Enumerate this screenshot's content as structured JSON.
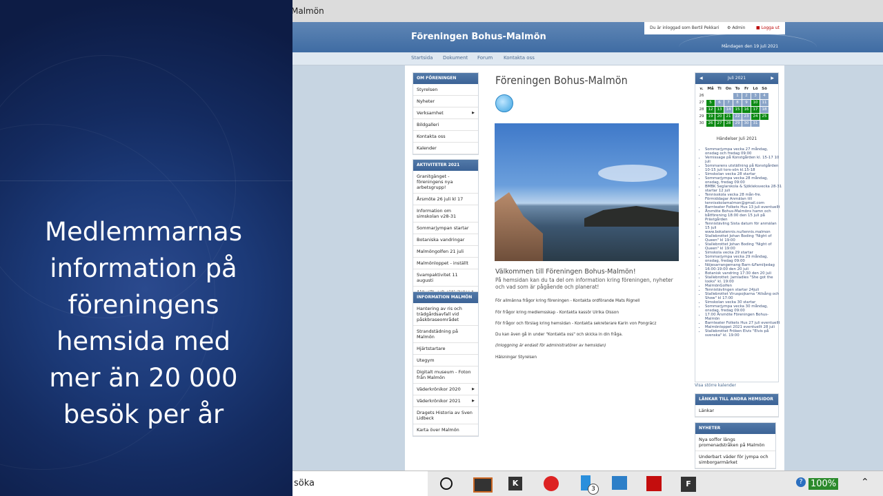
{
  "locale": "sv-SE",
  "slide": {
    "title_lines": [
      "Medlemmarnas",
      "information på",
      "föreningens",
      "hemsida med",
      "mer än 20 000",
      "besök per år"
    ]
  },
  "browser": {
    "window_title": "Malmön"
  },
  "site": {
    "name": "Föreningen Bohus-Malmön",
    "logged_in_text": "Du är inloggad som Bertil Pekkari",
    "admin_label": "Admin",
    "logout_label": "Logga ut",
    "date": "Måndagen den 19 juli 2021",
    "nav": [
      "Startsida",
      "Dokument",
      "Forum",
      "Kontakta oss"
    ]
  },
  "left_sidebar": {
    "about": {
      "title": "OM FÖRENINGEN",
      "items": [
        "Styrelsen",
        "Nyheter",
        "Verksamhet",
        "Bildgalleri",
        "Kontakta oss",
        "Kalender"
      ]
    },
    "activities": {
      "title": "AKTIVITETER 2021",
      "items": [
        "Granitgänget - föreningens nya arbetsgrupp!",
        "Årsmöte 26 juli kl 17",
        "Information om simskolan v28-31",
        "Sommarjympan startar",
        "Botaniska vandringar",
        "Malmöngolfen 21 juli",
        "Malmönloppet - inställt",
        "Svampaktivitet 11 augusti",
        "Aktuellt- och aktiviteter"
      ]
    },
    "info": {
      "title": "INFORMATION MALMÖN",
      "items": [
        "Hantering av ris och trädgårdsavfall vid påskbraseområdet",
        "Strandstädning på Malmön",
        "Hjärtstartare",
        "Utegym",
        "Digitalt museum - Foton från Malmön",
        "Väderkrönikor 2020",
        "Väderkrönikor 2021",
        "Dragets Historia av Sven Lidbeck",
        "Karta över Malmön"
      ]
    }
  },
  "main": {
    "title": "Föreningen Bohus-Malmön",
    "welcome_heading": "Välkommen till Föreningen Bohus-Malmön!",
    "welcome_text": "På hemsidan kan du ta del om information kring föreningen, nyheter och vad som är pågående och planerat!",
    "paragraphs": [
      "För allmänna frågor kring föreningen - Kontakta ordförande Mats Rignell",
      "För frågor kring medlemsskap - Kontakta kassör Ulrika Olsson",
      "För frågor och förslag kring hemsidan - Kontakta sekreterare Karin von Pongrácz",
      "Du kan även gå in under \"Kontakta oss\" och skicka in din fråga.",
      "(Inloggning är endast för administratörer av hemsidan)",
      "Hälsningar Styrelsen"
    ]
  },
  "calendar": {
    "month_label": "Juli 2021",
    "headers": [
      "v.",
      "Må",
      "Ti",
      "On",
      "To",
      "Fr",
      "Lö",
      "Sö"
    ],
    "weeks": [
      {
        "wk": "26",
        "days": [
          "",
          "",
          "",
          "1",
          "2",
          "3",
          "4"
        ]
      },
      {
        "wk": "27",
        "days": [
          "5",
          "6",
          "7",
          "8",
          "9",
          "10",
          "11"
        ]
      },
      {
        "wk": "28",
        "days": [
          "12",
          "13",
          "14",
          "15",
          "16",
          "17",
          "18"
        ]
      },
      {
        "wk": "29",
        "days": [
          "19",
          "20",
          "21",
          "22",
          "23",
          "24",
          "25"
        ]
      },
      {
        "wk": "30",
        "days": [
          "26",
          "27",
          "28",
          "29",
          "30",
          "31",
          ""
        ]
      }
    ],
    "events_title": "Händelser Juli 2021",
    "events": [
      "Sommarjympa vecka 27 måndag, onsdag och fredag 09:00",
      "Vernissage på Konstgården kl. 15-17 10 juli",
      "Sommarens utställning på Konstgården 10-15 juli tors-sön kl.15-18",
      "Simskolan vecka 28 startar",
      "Sommarjympa vecka 28 måndag, onsdag, fredag 09:00",
      "BMBK Seglarskola & Sjökleksvecka 28-31 startar 12 juli",
      "Tennisskola vecka 28 mån-fre. Förmiddagar Anmälan till tennisskolamalmon@gmail.com",
      "Barnteater Folkets Hus 13 juli eventuellt",
      "Årsmöte Bohus-Malmöns hamn och båtförening 18:00 den 15 juli på Prästgården",
      "Tennistävling Sista datum för anmälan 15 juli www.bokatennis.nu/tennis.malmon",
      "Stallebrottet Johan Boding \"Night of Queen\" kl 19:00",
      "Stallebrottet Johan Boding \"Night of Queen\" kl 19:00",
      "Simskola vecka 29 startar",
      "Sommarjympa vecka 29 måndag, onsdag, fredag 09:00",
      "Nöjesarrangemang Barn-&Familjedag 16:00-19:00 den 20 juli",
      "Botanisk vandring 17:30 den 20 juli",
      "Stallebrottet: Jamladies \"She got the looks\" kl. 19:00",
      "MalmönGolfen",
      "Tennistävlingen startar 24juli",
      "Stallebrottet Viruspojkarna \"Allsång och Show\" kl 17:00",
      "Simskolan vecka 30 startar",
      "Sommarjympa vecka 30 måndag, onsdag, fredag 09:00",
      "17:00 Årsmöte Föreningen Bohus-Malmön",
      "Barnteater Folkets Hus 27 juli eventuellt",
      "Malmönloppet 2021 eventuellt 28 juli",
      "Stallebrottet Fröken Elvis \"Elvis på svenska\" kl. 19:00"
    ],
    "bigger_link": "Visa större kalender"
  },
  "right_sidebar": {
    "links": {
      "title": "LÄNKAR TILL ANDRA HEMSIDOR",
      "items": [
        "Länkar"
      ]
    },
    "news": {
      "title": "NYHETER",
      "items": [
        "Nya soffor längs promenadstråken på Malmön",
        "Underbart väder för jympa och simborgarmärket"
      ]
    }
  },
  "taskbar": {
    "search_placeholder": "söka",
    "zoom": "100%",
    "badge_count": "3",
    "taskbar_icons": [
      "cortana-icon",
      "media-app-icon",
      "k-app-icon",
      "backup-app-icon",
      "files-app-icon",
      "photos-app-icon",
      "acrobat-icon",
      "f-app-icon"
    ]
  },
  "colors": {
    "header_blue": "#3f6ca3",
    "calendar_green": "#0c8a14",
    "calendar_blue": "#8aa4c8",
    "slide_bg": "#142b60"
  }
}
